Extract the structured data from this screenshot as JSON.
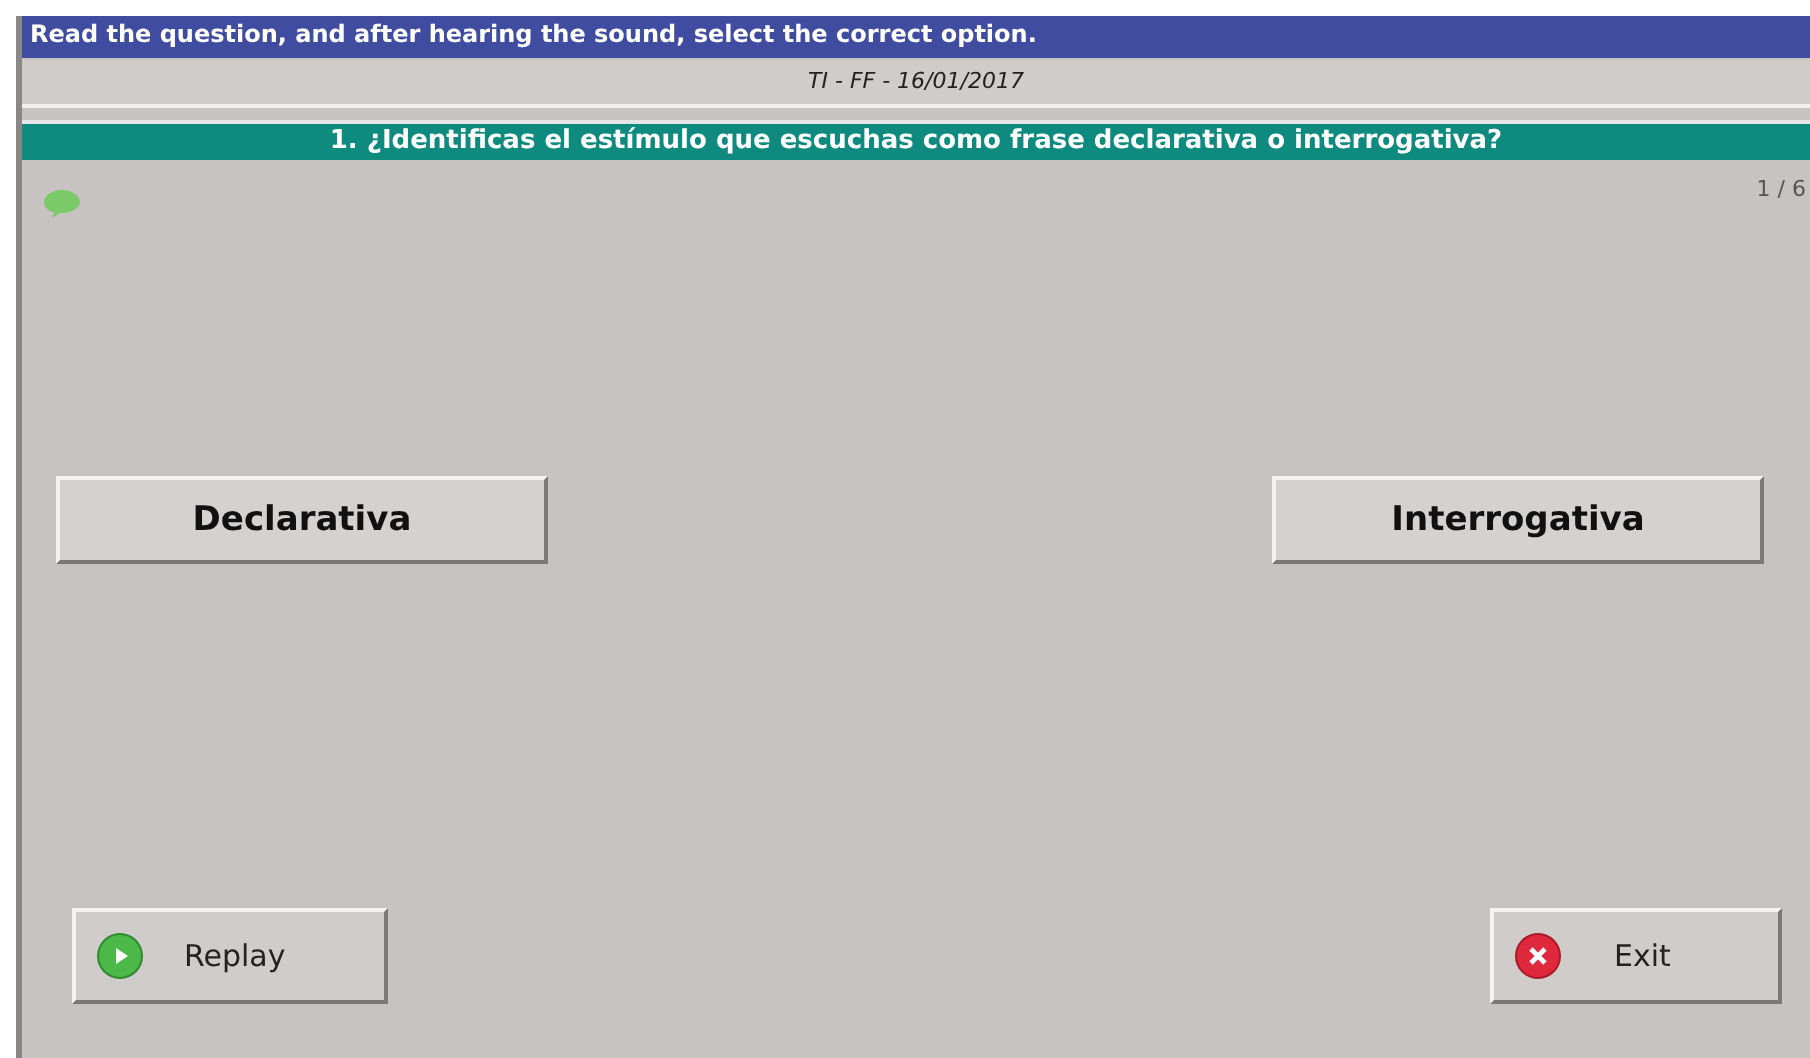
{
  "window": {
    "title": "Read the question, and after hearing the sound, select the correct option."
  },
  "subtitle": "TI - FF - 16/01/2017",
  "question": "1. ¿Identificas el estímulo que escuchas como frase declarativa o interrogativa?",
  "counter": "1 / 6",
  "options": [
    {
      "label": "Declarativa"
    },
    {
      "label": "Interrogativa"
    }
  ],
  "footer_buttons": [
    {
      "kind": "replay",
      "label": "Replay"
    },
    {
      "kind": "exit",
      "label": "Exit"
    }
  ]
}
